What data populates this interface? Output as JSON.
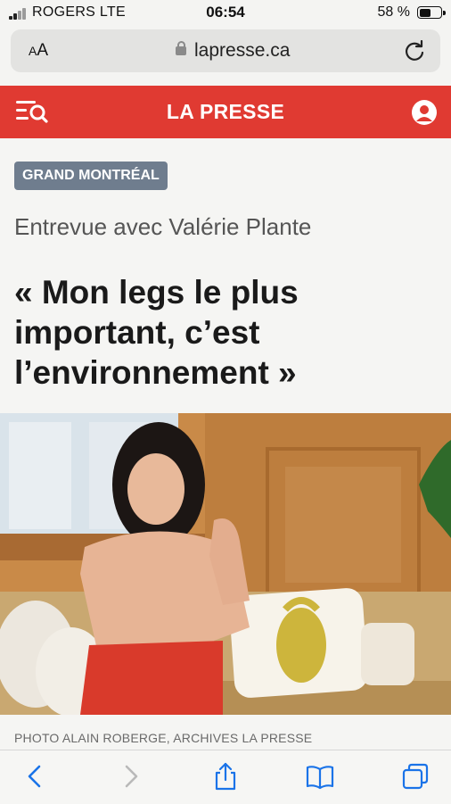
{
  "status_bar": {
    "carrier": "ROGERS  LTE",
    "time": "06:54",
    "battery_percent": "58 %",
    "battery_level": 0.58
  },
  "browser": {
    "text_size_label": "AA",
    "domain": "lapresse.ca"
  },
  "site_header": {
    "brand": "LA PRESSE"
  },
  "article": {
    "section": "GRAND MONTRÉAL",
    "kicker": "Entrevue avec Valérie Plante",
    "headline": "« Mon legs le plus important, c’est l’environnement »",
    "photo_credit": "PHOTO ALAIN ROBERGE, ARCHIVES LA PRESSE"
  },
  "colors": {
    "brand_red": "#e03a32",
    "section_tag": "#6f7d8e",
    "ios_blue": "#1a73e8"
  },
  "icons": {
    "toolbar": [
      "back-icon",
      "forward-icon",
      "share-icon",
      "bookmarks-icon",
      "tabs-icon"
    ]
  }
}
